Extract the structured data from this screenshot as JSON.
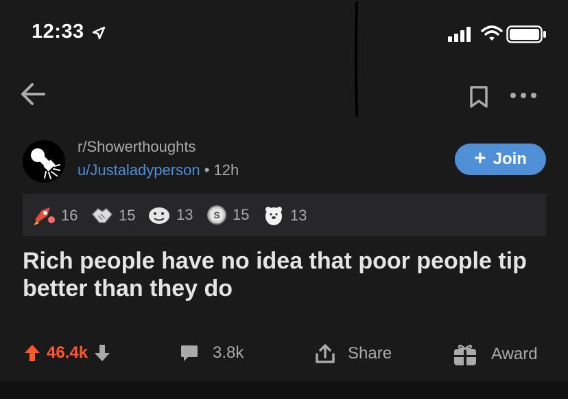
{
  "status_bar": {
    "time": "12:33",
    "icons": [
      "location-arrow-icon",
      "signal-icon",
      "wifi-icon",
      "battery-icon"
    ]
  },
  "nav": {
    "icons": [
      "back-arrow-icon",
      "bookmark-icon",
      "more-icon"
    ]
  },
  "post": {
    "subreddit": "r/Showerthoughts",
    "username": "u/Justaladyperson",
    "separator": "•",
    "age": "12h",
    "join_label": "Join",
    "join_plus": "+",
    "title": "Rich people have no idea that poor people tip better than they do"
  },
  "awards": [
    {
      "icon": "rocket-like-award-icon",
      "count": "16"
    },
    {
      "icon": "handshake-award-icon",
      "count": "15"
    },
    {
      "icon": "face-award-icon",
      "count": "13"
    },
    {
      "icon": "silver-coin-award-icon",
      "count": "15"
    },
    {
      "icon": "bear-award-icon",
      "count": "13"
    }
  ],
  "actions": {
    "score": "46.4k",
    "comments": "3.8k",
    "share_label": "Share",
    "award_label": "Award"
  },
  "colors": {
    "background": "#1a1a1b",
    "accent_blue": "#4f8fd6",
    "upvote_orange": "#ff5a2b",
    "muted_text": "#a8aaab",
    "award_strip": "#272729"
  }
}
